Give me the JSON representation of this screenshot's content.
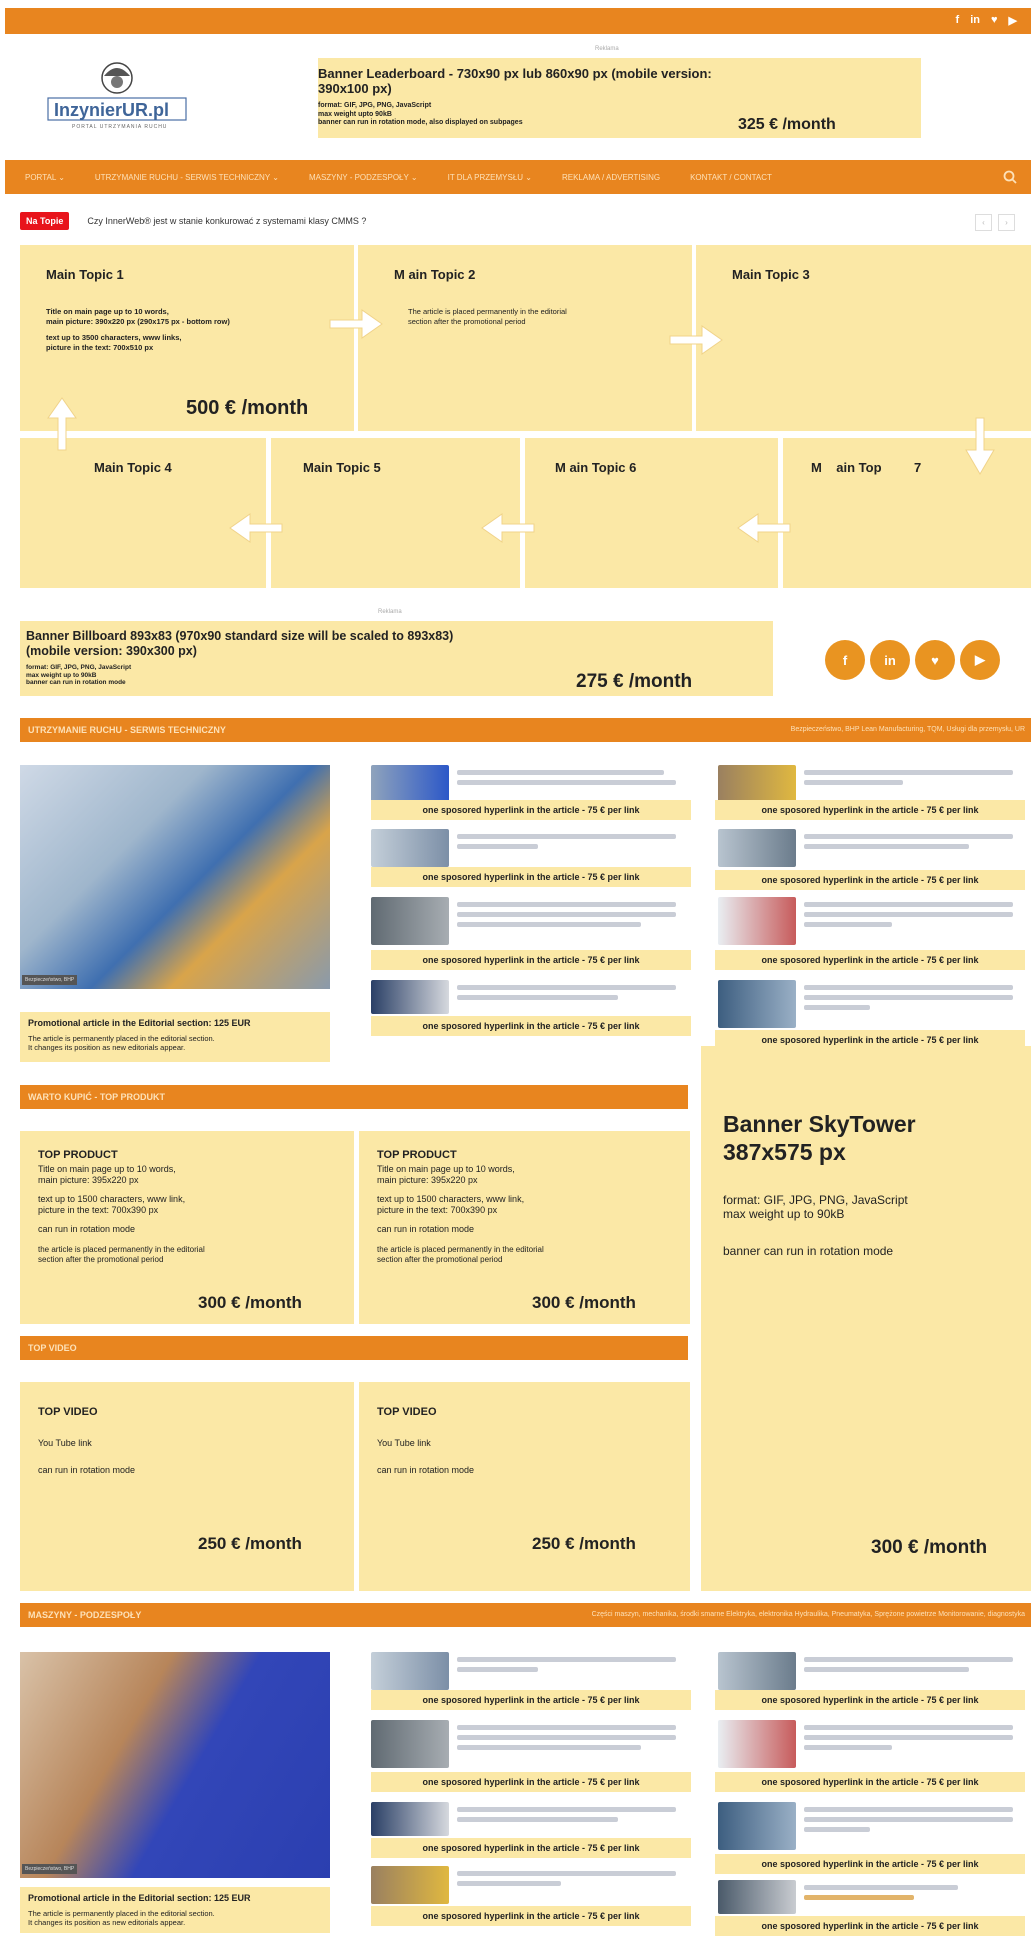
{
  "header": {
    "social": [
      "f",
      "in",
      "♥",
      "▶"
    ],
    "ad_label": "Reklama",
    "logo_text": "InzynierUR.pl",
    "logo_sub": "PORTAL UTRZYMANIA RUCHU",
    "leaderboard": {
      "title": "Banner Leaderboard - 730x90 px lub 860x90 px (mobile version: 390x100 px)",
      "l1": "format: GIF, JPG, PNG, JavaScript",
      "l2": "max weight upto 90kB",
      "l3": "banner can run in rotation mode, also displayed on subpages",
      "price": "325 € /month"
    }
  },
  "nav": [
    "PORTAL ⌄",
    "UTRZYMANIE RUCHU - SERWIS TECHNICZNY ⌄",
    "MASZYNY - PODZESPOŁY ⌄",
    "IT DLA PRZEMYSŁU ⌄",
    "REKLAMA / ADVERTISING",
    "KONTAKT / CONTACT"
  ],
  "ticker": {
    "badge": "Na Topie",
    "text": "Czy InnerWeb® jest w stanie konkurować z systemami klasy CMMS ?"
  },
  "topics": {
    "t1": "Main Topic 1",
    "t2": "M    ain Topic 2",
    "t3": "Main Topic 3",
    "t4": "Main Topic 4",
    "t5": "Main Topic 5",
    "t6": "M    ain Topic 6",
    "t7": "M    ain Top         7",
    "t1_desc1": "Title on main page up to 10 words,",
    "t1_desc2": "main picture: 390x220 px (290x175 px - bottom row)",
    "t1_desc3": "text up to 3500 characters, www links,",
    "t1_desc4": "picture in the text: 700x510 px",
    "t2_desc1": "The article is placed permanently in the editorial",
    "t2_desc2": "section after the promotional period",
    "t1_price": "500 € /month"
  },
  "billboard": {
    "title": "Banner Billboard 893x83 (970x90 standard size will be scaled to 893x83)",
    "title2": "(mobile version: 390x300 px)",
    "l1": "format: GIF, JPG, PNG, JavaScript",
    "l2": "max weight up to 90kB",
    "l3": "banner can run in rotation mode",
    "price": "275 € /month",
    "circles": [
      "f",
      "in",
      "♥",
      "▶"
    ]
  },
  "sec1": {
    "title": "UTRZYMANIE RUCHU - SERWIS TECHNICZNY",
    "right": "Bezpieczeństwo, BHP      Lean Manufacturing, TQM, Usługi dla przemysłu, UR"
  },
  "sponsored": "one sposored hyperlink in the article - 75 € per link",
  "promo": {
    "title": "Promotional article in the Editorial section: 125 EUR",
    "d1": "The article is permanently placed in the editorial section.",
    "d2": "It changes its position as new editorials appear.",
    "photo_label": "Bezpieczeństwo, BHP"
  },
  "sec2": {
    "title": "WARTO KUPIĆ - TOP PRODUKT"
  },
  "product": {
    "h": "TOP PRODUCT",
    "l1": "Title on main page up to 10 words,",
    "l2": "main picture: 395x220 px",
    "l3": "text up to 1500 characters, www link,",
    "l4": "picture in the text: 700x390 px",
    "l5": "can run in rotation mode",
    "l6": "the article is placed permanently in the editorial",
    "l7": "section after the promotional period",
    "price": "300 € /month"
  },
  "sky": {
    "title1": "Banner SkyTower",
    "title2": "387x575 px",
    "l1": "format: GIF, JPG, PNG, JavaScript",
    "l2": "max weight up to 90kB",
    "l3": "banner can run in rotation mode",
    "price": "300 € /month"
  },
  "sec3": {
    "title": "TOP VIDEO"
  },
  "video": {
    "h": "TOP VIDEO",
    "l1": "You Tube link",
    "l2": "can run in rotation mode",
    "price": "250 € /month"
  },
  "sec4": {
    "title": "MASZYNY - PODZESPOŁY",
    "right": "Części maszyn, mechanika, środki smarne      Elektryka, elektronika      Hydraulika, Pneumatyka, Sprężone powietrze      Monitorowanie, diagnostyka"
  },
  "promo2_label": "Bezpieczeństwo, BHP"
}
